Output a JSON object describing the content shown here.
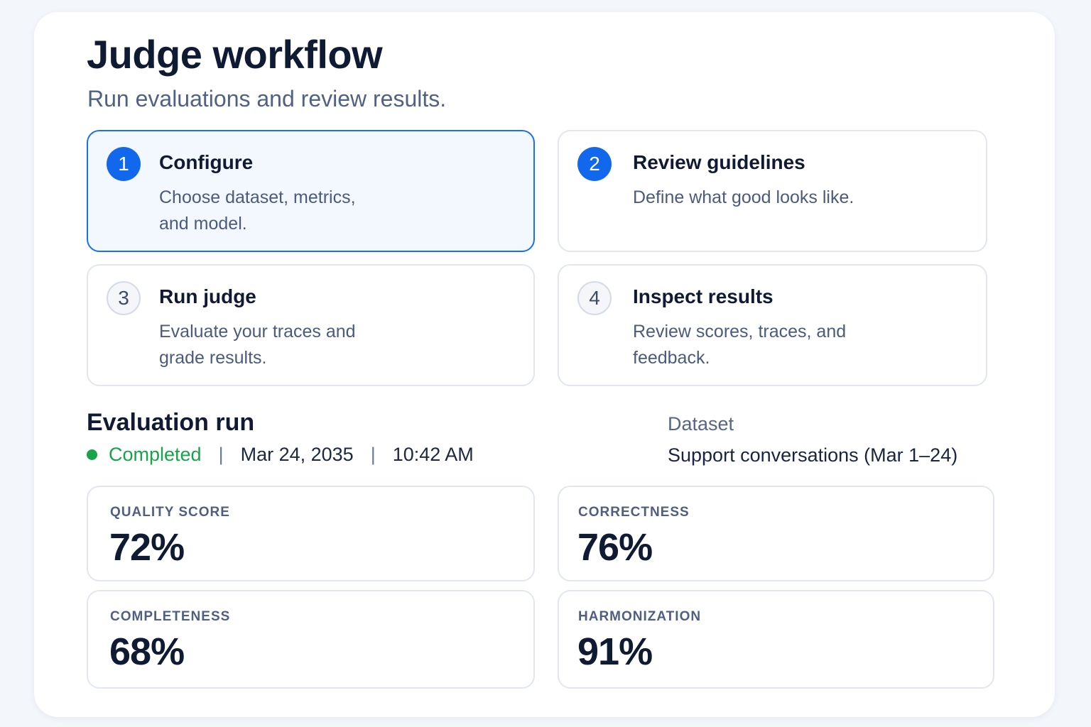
{
  "header": {
    "title": "Judge workflow",
    "subtitle": "Run evaluations and review results."
  },
  "steps": [
    {
      "number": "1",
      "title": "Configure",
      "description": "Choose dataset, metrics, and model.",
      "active": true
    },
    {
      "number": "2",
      "title": "Review guidelines",
      "description": "Define what good looks like.",
      "active": false
    },
    {
      "number": "3",
      "title": "Run judge",
      "description": "Evaluate your traces and grade results.",
      "active": false
    },
    {
      "number": "4",
      "title": "Inspect results",
      "description": "Review scores, traces, and feedback.",
      "active": false
    }
  ],
  "evaluation_run": {
    "title": "Evaluation run",
    "status": "Completed",
    "status_color": "#16a34a",
    "separator": "|",
    "date": "Mar 24, 2035",
    "time": "10:42 AM",
    "dataset_label": "Dataset",
    "dataset_value": "Support conversations (Mar 1–24)"
  },
  "metrics": [
    {
      "label": "QUALITY SCORE",
      "value": "72%"
    },
    {
      "label": "CORRECTNESS",
      "value": "76%"
    },
    {
      "label": "COMPLETENESS",
      "value": "68%"
    },
    {
      "label": "HARMONIZATION",
      "value": "91%"
    }
  ],
  "colors": {
    "accent": "#1268ec",
    "status_success": "#16a34a",
    "text_primary": "#0f1a33",
    "text_secondary": "#4f6185"
  }
}
